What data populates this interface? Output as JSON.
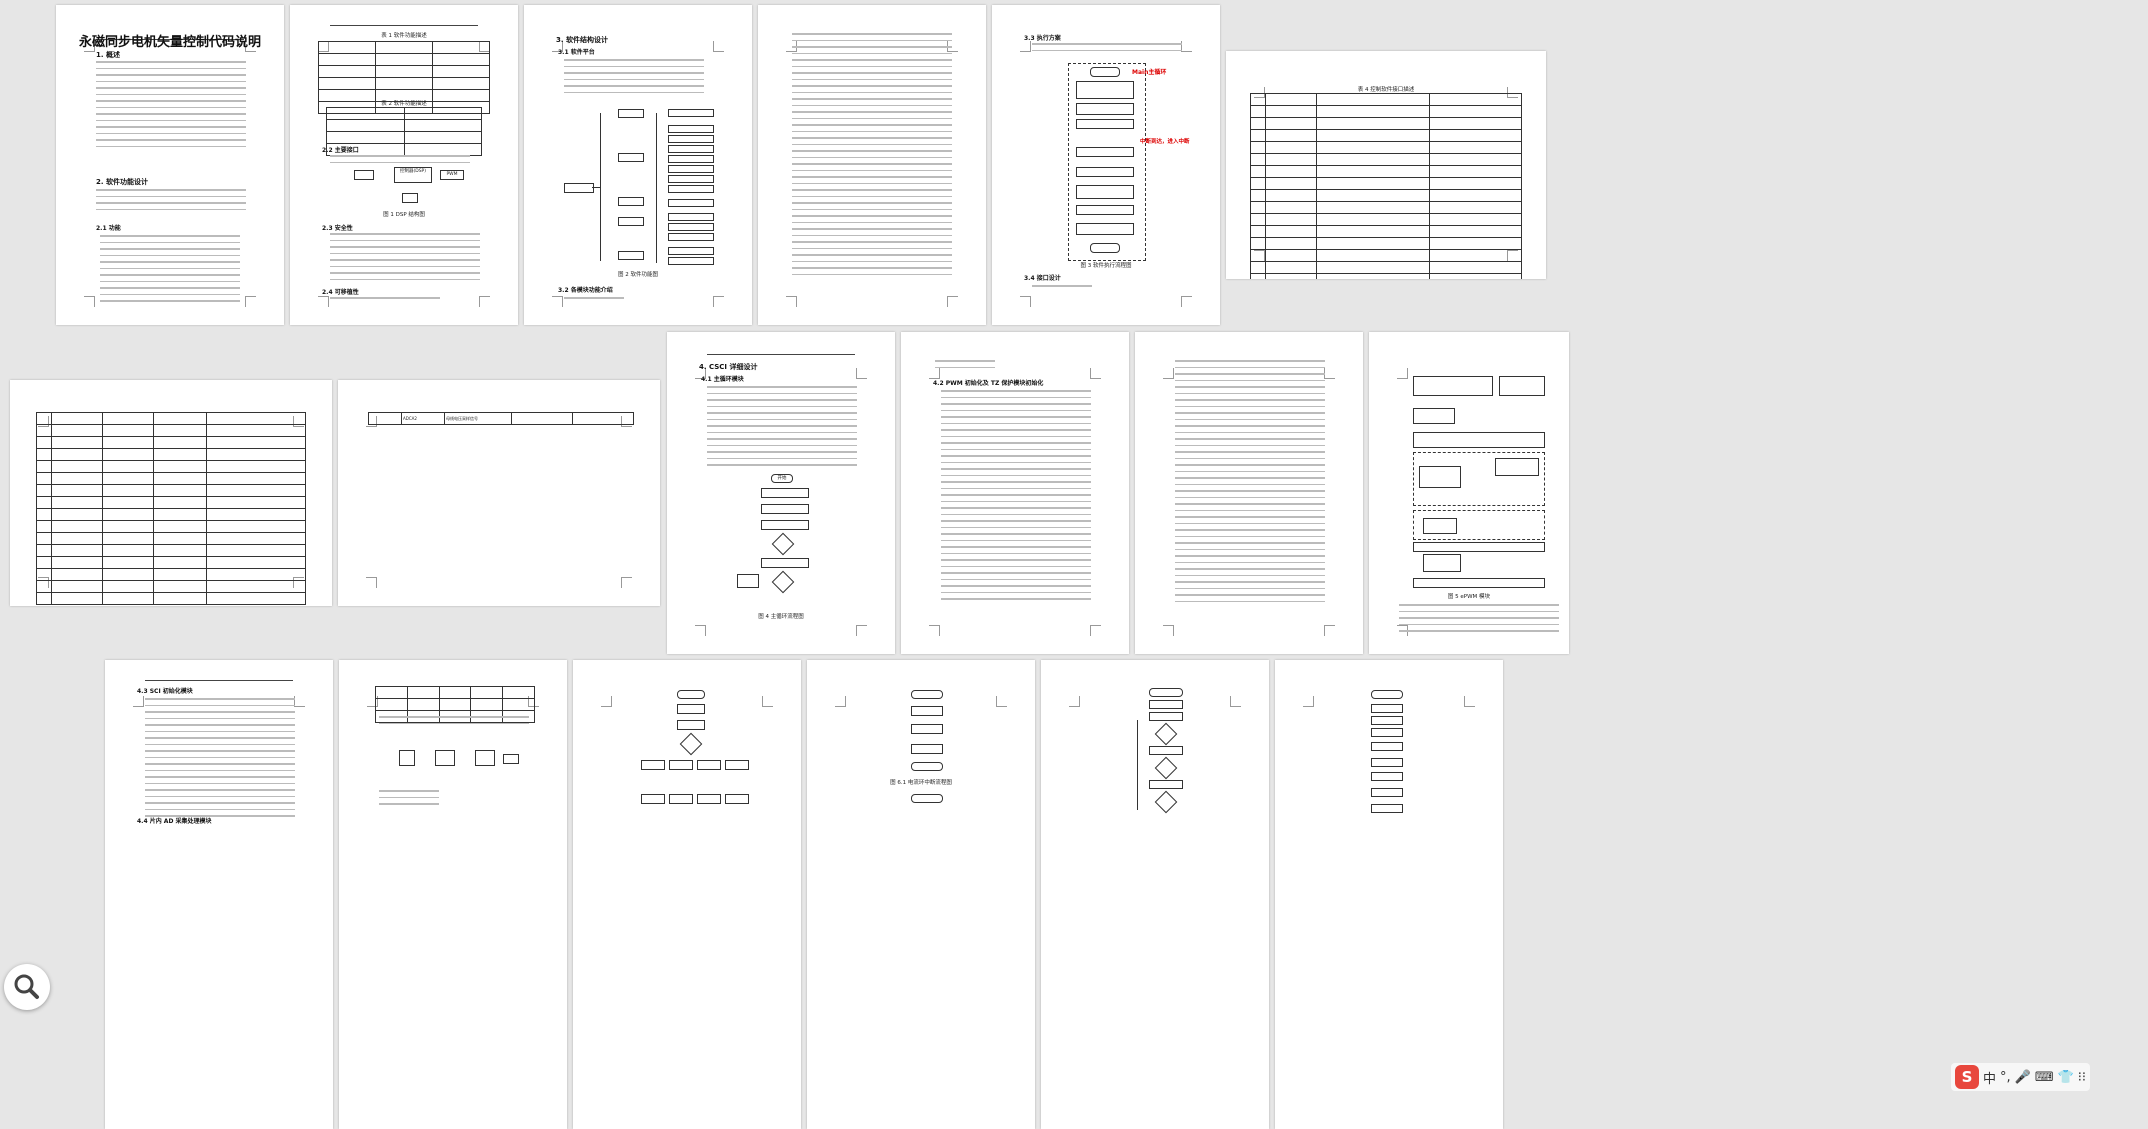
{
  "document": {
    "title": "永磁同步电机矢量控制代码说明",
    "sections": {
      "s1": "1. 概述",
      "s2": "2. 软件功能设计",
      "s21": "2.1 功能",
      "s22": "2.2 主要接口",
      "s23": "2.3 安全性",
      "s24": "2.4 可移植性",
      "s3": "3. 软件结构设计",
      "s31": "3.1 软件平台",
      "s32": "3.2 各模块功能介绍",
      "s33": "3.3 执行方案",
      "s34": "3.4 接口设计",
      "s4": "4. CSCI 详细设计",
      "s41": "4.1 主循环模块",
      "s42": "4.2 PWM 初始化及 TZ 保护模块初始化",
      "s43": "4.3 SCI 初始化模块",
      "s44": "4.4 片内 AD 采集处理模块"
    },
    "captions": {
      "fig1": "图 1 DSP 结构图",
      "fig2": "图 2 软件功能图",
      "fig3": "图 3 软件执行流程图",
      "fig4": "图 4 主循环流程图",
      "fig5": "图 5 ePWM 模块",
      "table1": "表 1 软件功能描述",
      "table2": "表 2 软件功能描述",
      "table4": "表 4 控制软件接口描述",
      "fig61": "图 6.1 电流环中断流程图"
    },
    "labels": {
      "main_loop": "Main主循环",
      "interrupt": "中断到达，进入中断",
      "dsp": "控制器(DSP)",
      "pwm": "PWM",
      "start": "开始",
      "end": "结束",
      "adc_row": "ADCA2",
      "adc_desc": "母线电压采样信号"
    }
  },
  "ui": {
    "search_icon": "magnifier-icon",
    "ime": {
      "logo": "S",
      "lang": "中",
      "punct": "°,",
      "mic": "🎤",
      "keyboard": "⌨",
      "skin": "👕",
      "grid": "⁝⁝"
    }
  }
}
